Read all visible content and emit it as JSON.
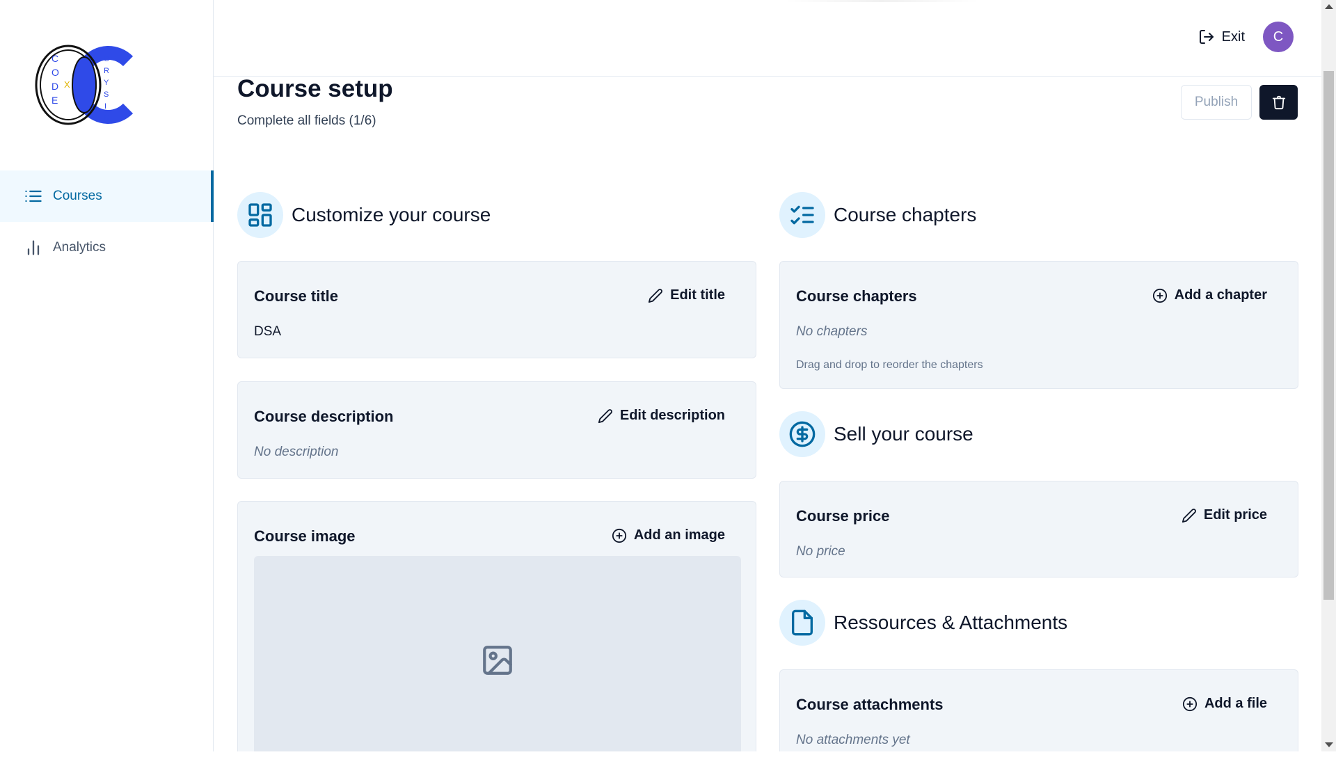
{
  "sidebar": {
    "logo": {
      "left_letters": [
        "C",
        "O",
        "D",
        "E"
      ],
      "middle_letter": "X",
      "right_letters": [
        "C",
        "R",
        "Y",
        "S",
        "I",
        "S"
      ],
      "colors": {
        "outline": "#111111",
        "brand": "#2f4ae8",
        "accent": "#e0b400"
      }
    },
    "items": [
      {
        "label": "Courses",
        "icon": "list-icon",
        "active": true
      },
      {
        "label": "Analytics",
        "icon": "bar-chart-icon",
        "active": false
      }
    ]
  },
  "header": {
    "exit_label": "Exit",
    "avatar_initial": "C",
    "avatar_color": "#7e57c2"
  },
  "page": {
    "title": "Course setup",
    "subtitle": "Complete all fields (1/6)",
    "publish_label": "Publish"
  },
  "sections": {
    "customize": {
      "title": "Customize your course",
      "icon": "layout-dashboard-icon"
    },
    "chapters": {
      "title": "Course chapters",
      "icon": "list-checks-icon"
    },
    "sell": {
      "title": "Sell your course",
      "icon": "circle-dollar-icon"
    },
    "resources": {
      "title": "Ressources & Attachments",
      "icon": "file-icon"
    }
  },
  "cards": {
    "title": {
      "label": "Course title",
      "action": "Edit title",
      "value": "DSA"
    },
    "description": {
      "label": "Course description",
      "action": "Edit description",
      "empty": "No description"
    },
    "image": {
      "label": "Course image",
      "action": "Add an image"
    },
    "chapters": {
      "label": "Course chapters",
      "action": "Add a chapter",
      "empty": "No chapters",
      "hint": "Drag and drop to reorder the chapters"
    },
    "price": {
      "label": "Course price",
      "action": "Edit price",
      "empty": "No price"
    },
    "attachments": {
      "label": "Course attachments",
      "action": "Add a file",
      "empty": "No attachments yet"
    }
  },
  "colors": {
    "accent": "#0369a1",
    "accent_bg": "#e0f2fe",
    "card_bg": "#f1f5f9",
    "dark": "#0f172a"
  }
}
